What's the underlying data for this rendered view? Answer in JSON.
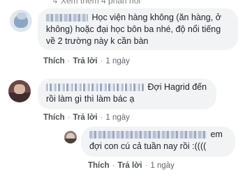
{
  "more_replies": {
    "arrow": "↳",
    "label": "Xem thêm 4 phản hồi"
  },
  "comments": [
    {
      "text": "Học viện hàng không (ăn hàng, ở không) hoặc đại học bôn ba nhé, độ nổi tiếng về 2 trường này k cần bàn",
      "actions": {
        "like": "Thích",
        "reply": "Trả lời",
        "time": "1 ngày"
      }
    },
    {
      "text": "Đợi Hagrid đến rồi làm gì thì làm bác ạ",
      "actions": {
        "like": "Thích",
        "reply": "Trả lời",
        "time": "1 ngày"
      }
    },
    {
      "text": "em đợi con cú cả tuần nay rồi :((((",
      "actions": {
        "like": "Thích",
        "reply": "Trả lời",
        "time": "1 ngày"
      }
    }
  ],
  "colors": {
    "bubble": "#f2f3f5",
    "meta": "#606770",
    "text": "#1d2129"
  }
}
